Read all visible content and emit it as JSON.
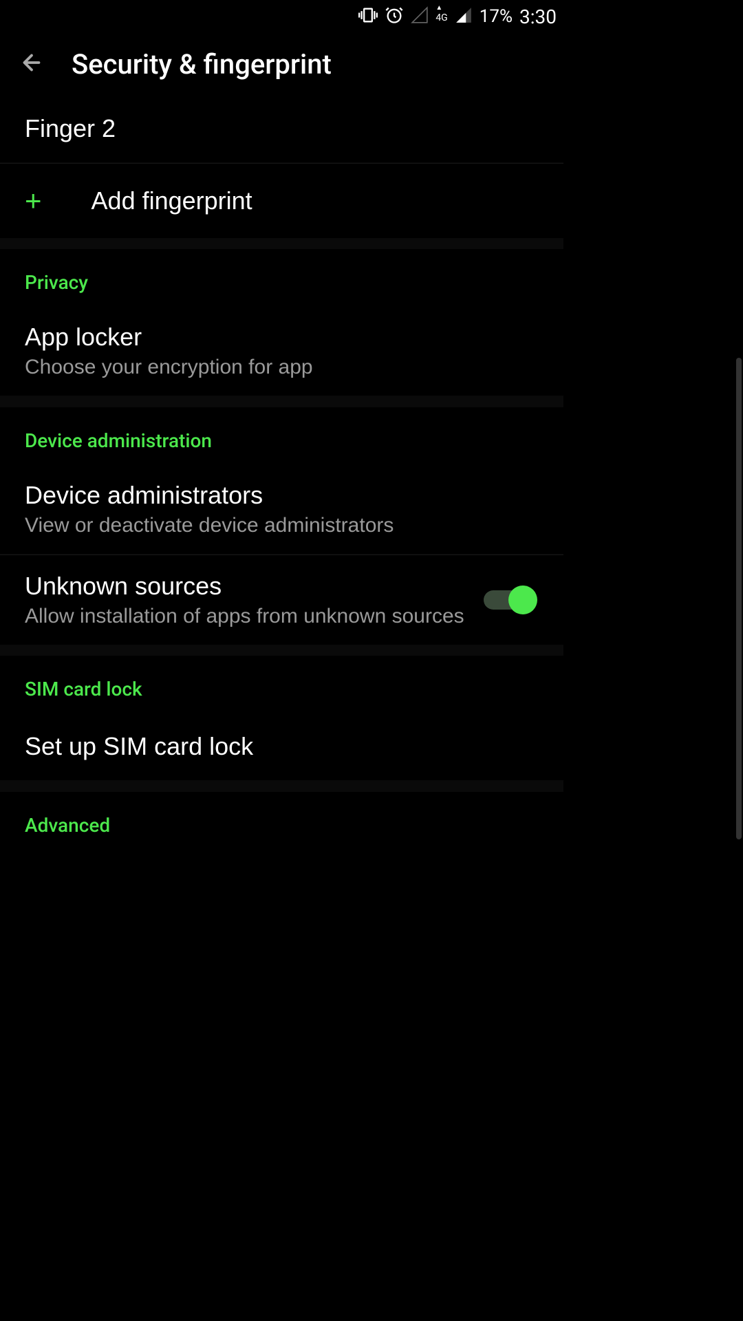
{
  "status_bar": {
    "network_label": "4G",
    "battery": "17%",
    "time": "3:30"
  },
  "header": {
    "title": "Security & fingerprint"
  },
  "fingerprints": {
    "items": [
      {
        "label": "Finger 2"
      }
    ],
    "add_label": "Add fingerprint"
  },
  "sections": {
    "privacy": {
      "header": "Privacy",
      "app_locker": {
        "title": "App locker",
        "subtitle": "Choose your encryption for app"
      }
    },
    "device_admin": {
      "header": "Device administration",
      "administrators": {
        "title": "Device administrators",
        "subtitle": "View or deactivate device administrators"
      },
      "unknown_sources": {
        "title": "Unknown sources",
        "subtitle": "Allow installation of apps from unknown sources",
        "enabled": true
      }
    },
    "sim_lock": {
      "header": "SIM card lock",
      "setup": {
        "title": "Set up SIM card lock"
      }
    },
    "advanced": {
      "header": "Advanced"
    }
  }
}
